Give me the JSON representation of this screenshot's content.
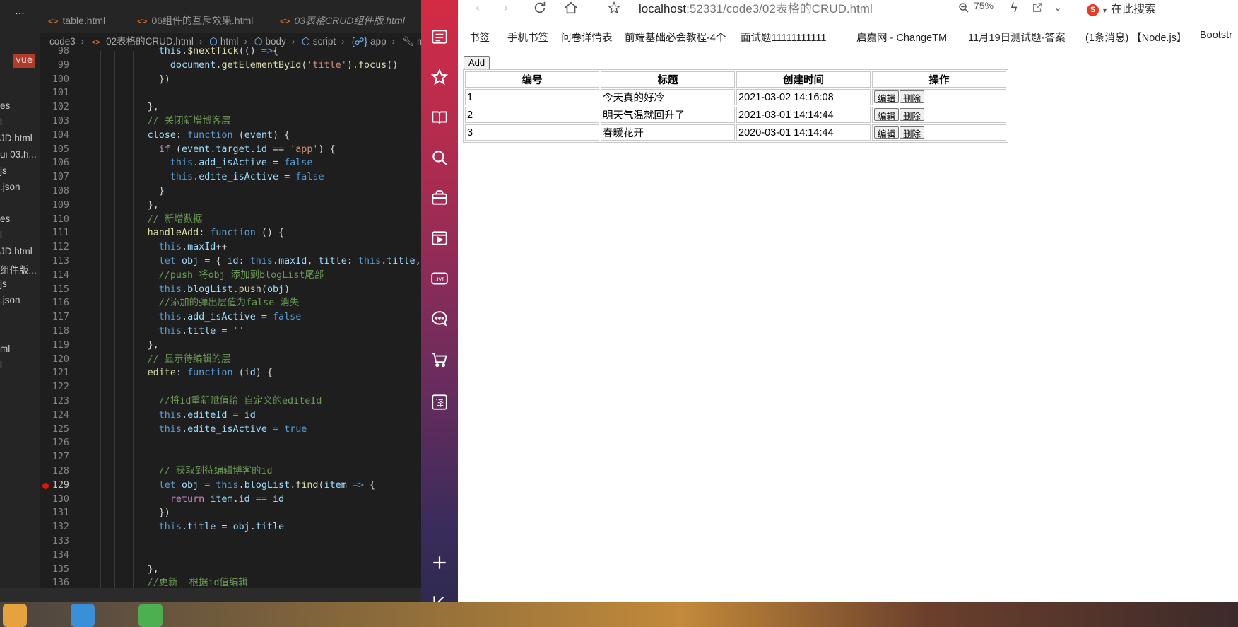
{
  "vscode": {
    "explorer": {
      "vue_badge": "vue",
      "files": [
        "es",
        "l",
        "JD.html",
        "ui 03.h...",
        "js",
        ".json",
        "es",
        "l",
        "JD.html",
        "组件版...",
        "js",
        ".json",
        "ml",
        "l"
      ]
    },
    "tabs": [
      {
        "icon": "<>",
        "label": "table.html"
      },
      {
        "icon": "<>",
        "label": "06组件的互斥效果.html"
      },
      {
        "icon": "<>",
        "label": "03表格CRUD组件版.html"
      }
    ],
    "breadcrumb": [
      "code3",
      "02表格的CRUD.html",
      "html",
      "body",
      "script",
      "app",
      "meth"
    ],
    "code_lines": [
      {
        "n": "98",
        "html": "            <span class=\"prop\">this</span>.<span class=\"fn\">$nextTick</span>(() <span class=\"kw\">=&gt;</span>{"
      },
      {
        "n": "99",
        "html": "              <span class=\"prop\">document</span>.<span class=\"fn\">getElementById</span>(<span class=\"str\">'title'</span>).<span class=\"fn\">focus</span>()"
      },
      {
        "n": "100",
        "html": "            })"
      },
      {
        "n": "101",
        "html": ""
      },
      {
        "n": "102",
        "html": "          },"
      },
      {
        "n": "103",
        "html": "          <span class=\"cm\">// 关闭新增博客层</span>"
      },
      {
        "n": "104",
        "html": "          <span class=\"prop\">close</span>: <span class=\"kw\">function</span> (<span class=\"prop\">event</span>) {"
      },
      {
        "n": "105",
        "html": "            <span class=\"ctl\">if</span> (<span class=\"prop\">event</span>.<span class=\"prop\">target</span>.<span class=\"prop\">id</span> == <span class=\"str\">'app'</span>) {"
      },
      {
        "n": "106",
        "html": "              <span class=\"kw\">this</span>.<span class=\"prop\">add_isActive</span> = <span class=\"kw\">false</span>"
      },
      {
        "n": "107",
        "html": "              <span class=\"kw\">this</span>.<span class=\"prop\">edite_isActive</span> = <span class=\"kw\">false</span>"
      },
      {
        "n": "108",
        "html": "            }"
      },
      {
        "n": "109",
        "html": "          },"
      },
      {
        "n": "110",
        "html": "          <span class=\"cm\">// 新增数据</span>"
      },
      {
        "n": "111",
        "html": "          <span class=\"fn\">handleAdd</span>: <span class=\"kw\">function</span> () {"
      },
      {
        "n": "112",
        "html": "            <span class=\"kw\">this</span>.<span class=\"prop\">maxId</span>++"
      },
      {
        "n": "113",
        "html": "            <span class=\"kw\">let</span> <span class=\"prop\">obj</span> = { <span class=\"prop\">id</span>: <span class=\"kw\">this</span>.<span class=\"prop\">maxId</span>, <span class=\"prop\">title</span>: <span class=\"kw\">this</span>.<span class=\"prop\">title</span>, <span class=\"prop\">cr</span>"
      },
      {
        "n": "114",
        "html": "            <span class=\"cm\">//push 将obj 添加到blogList尾部</span>"
      },
      {
        "n": "115",
        "html": "            <span class=\"kw\">this</span>.<span class=\"prop\">blogList</span>.<span class=\"fn\">push</span>(<span class=\"prop\">obj</span>)"
      },
      {
        "n": "116",
        "html": "            <span class=\"cm\">//添加的弹出层值为false 消失</span>"
      },
      {
        "n": "117",
        "html": "            <span class=\"kw\">this</span>.<span class=\"prop\">add_isActive</span> = <span class=\"kw\">false</span>"
      },
      {
        "n": "118",
        "html": "            <span class=\"kw\">this</span>.<span class=\"prop\">title</span> = <span class=\"str\">''</span>"
      },
      {
        "n": "119",
        "html": "          },"
      },
      {
        "n": "120",
        "html": "          <span class=\"cm\">// 显示待编辑的层</span>"
      },
      {
        "n": "121",
        "html": "          <span class=\"fn\">edite</span>: <span class=\"kw\">function</span> (<span class=\"prop\">id</span>) {"
      },
      {
        "n": "122",
        "html": ""
      },
      {
        "n": "123",
        "html": "            <span class=\"cm\">//将id重新赋值给 自定义的editeId</span>"
      },
      {
        "n": "124",
        "html": "            <span class=\"kw\">this</span>.<span class=\"prop\">editeId</span> = <span class=\"prop\">id</span>"
      },
      {
        "n": "125",
        "html": "            <span class=\"kw\">this</span>.<span class=\"prop\">edite_isActive</span> = <span class=\"kw\">true</span>"
      },
      {
        "n": "126",
        "html": ""
      },
      {
        "n": "127",
        "html": ""
      },
      {
        "n": "128",
        "html": "            <span class=\"cm\">// 获取到待编辑博客的id</span>"
      },
      {
        "n": "129",
        "html": "            <span class=\"kw\">let</span> <span class=\"prop\">obj</span> = <span class=\"kw\">this</span>.<span class=\"prop\">blogList</span>.<span class=\"fn\">find</span>(<span class=\"prop\">item</span> <span class=\"kw\">=&gt;</span> {",
        "bp": true
      },
      {
        "n": "130",
        "html": "              <span class=\"ctl\">return</span> <span class=\"prop\">item</span>.<span class=\"prop\">id</span> == <span class=\"prop\">id</span>"
      },
      {
        "n": "131",
        "html": "            })"
      },
      {
        "n": "132",
        "html": "            <span class=\"kw\">this</span>.<span class=\"prop\">title</span> = <span class=\"prop\">obj</span>.<span class=\"prop\">title</span>"
      },
      {
        "n": "133",
        "html": ""
      },
      {
        "n": "134",
        "html": ""
      },
      {
        "n": "135",
        "html": "          },"
      },
      {
        "n": "136",
        "html": "          <span class=\"cm\">//更新  根据id值编辑</span>"
      }
    ]
  },
  "browser": {
    "url_host": "localhost",
    "url_rest": ":52331/code3/02表格的CRUD.html",
    "zoom": "75%",
    "search_label": "在此搜索",
    "search_logo": "S",
    "bookmarks": [
      "书签",
      "手机书签",
      "问卷详情表",
      "前端基础必会教程-4个",
      "面试题11111111111",
      "启嘉网 - ChangeTM",
      "11月19日测试题-答案",
      "(1条消息) 【Node.js】",
      "Bootstr"
    ]
  },
  "page": {
    "add_label": "Add",
    "headers": [
      "编号",
      "标题",
      "创建时间",
      "操作"
    ],
    "rows": [
      {
        "id": "1",
        "title": "今天真的好冷",
        "time": "2021-03-02 14:16:08"
      },
      {
        "id": "2",
        "title": "明天气温就回升了",
        "time": "2021-03-01 14:14:44"
      },
      {
        "id": "3",
        "title": "春暖花开",
        "time": "2020-03-01 14:14:44"
      }
    ],
    "edit_label": "编辑",
    "delete_label": "删除"
  }
}
